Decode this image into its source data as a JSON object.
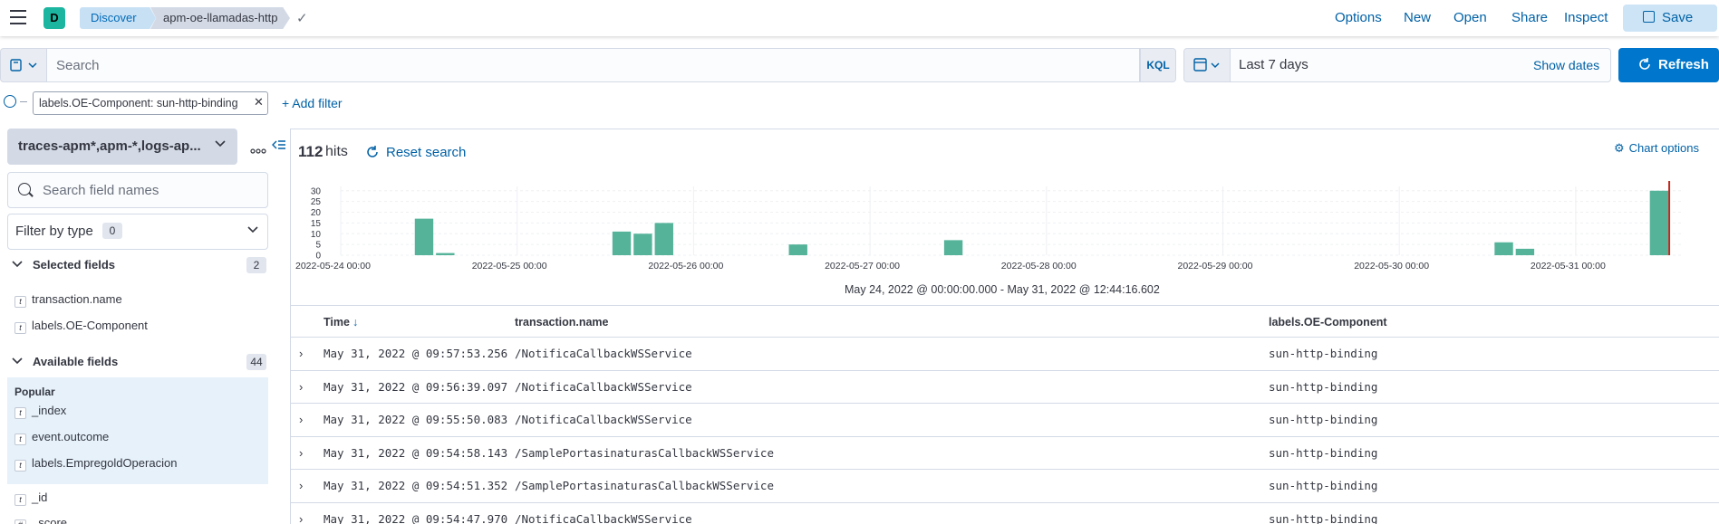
{
  "header": {
    "space_initial": "D",
    "breadcrumbs": [
      "Discover",
      "apm-oe-llamadas-http"
    ],
    "nav": [
      "Options",
      "New",
      "Open",
      "Share",
      "Inspect"
    ],
    "save_label": "Save"
  },
  "query": {
    "search_placeholder": "Search",
    "language": "KQL",
    "date_range": "Last 7 days",
    "show_dates": "Show dates",
    "refresh_label": "Refresh"
  },
  "filters": {
    "pills": [
      "labels.OE-Component: sun-http-binding"
    ],
    "add_label": "+ Add filter"
  },
  "sidebar": {
    "index_pattern": "traces-apm*,apm-*,logs-ap...",
    "field_search_placeholder": "Search field names",
    "filter_by_type_label": "Filter by type",
    "filter_by_type_count": "0",
    "selected_title": "Selected fields",
    "selected_count": "2",
    "selected_fields": [
      {
        "type": "t",
        "name": "transaction.name"
      },
      {
        "type": "t",
        "name": "labels.OE-Component"
      }
    ],
    "available_title": "Available fields",
    "available_count": "44",
    "popular_title": "Popular",
    "popular_fields": [
      {
        "type": "t",
        "name": "_index"
      },
      {
        "type": "t",
        "name": "event.outcome"
      },
      {
        "type": "t",
        "name": "labels.EmpregoldOperacion"
      }
    ],
    "other_fields": [
      {
        "type": "t",
        "name": "_id"
      },
      {
        "type": "#",
        "name": "_score"
      }
    ]
  },
  "main": {
    "hits": "112",
    "hits_label": "hits",
    "reset_label": "Reset search",
    "chart_options_label": "Chart options",
    "range_label": "May 24, 2022 @ 00:00:00.000 - May 31, 2022 @ 12:44:16.602"
  },
  "chart_data": {
    "type": "bar",
    "x_ticks": [
      "2022-05-24 00:00",
      "2022-05-25 00:00",
      "2022-05-26 00:00",
      "2022-05-27 00:00",
      "2022-05-28 00:00",
      "2022-05-29 00:00",
      "2022-05-30 00:00",
      "2022-05-31 00:00"
    ],
    "y_ticks": [
      0,
      5,
      10,
      15,
      20,
      25,
      30
    ],
    "ylim": [
      0,
      32
    ],
    "xlim_days": [
      0,
      7.53
    ],
    "bars": [
      {
        "day": 0.42,
        "value": 17
      },
      {
        "day": 0.54,
        "value": 1
      },
      {
        "day": 1.54,
        "value": 11
      },
      {
        "day": 1.66,
        "value": 10
      },
      {
        "day": 1.78,
        "value": 15
      },
      {
        "day": 2.54,
        "value": 5
      },
      {
        "day": 3.42,
        "value": 7
      },
      {
        "day": 6.54,
        "value": 6
      },
      {
        "day": 6.66,
        "value": 3
      },
      {
        "day": 7.42,
        "value": 30
      }
    ],
    "bar_width_days": 0.115,
    "bar_color": "#54b399",
    "now_marker_day": 7.53,
    "now_marker_color": "#bd271e"
  },
  "table": {
    "columns": [
      "Time",
      "transaction.name",
      "labels.OE-Component"
    ],
    "rows": [
      {
        "time": "May 31, 2022 @ 09:57:53.256",
        "name": "/NotificaCallbackWSService",
        "component": "sun-http-binding"
      },
      {
        "time": "May 31, 2022 @ 09:56:39.097",
        "name": "/NotificaCallbackWSService",
        "component": "sun-http-binding"
      },
      {
        "time": "May 31, 2022 @ 09:55:50.083",
        "name": "/NotificaCallbackWSService",
        "component": "sun-http-binding"
      },
      {
        "time": "May 31, 2022 @ 09:54:58.143",
        "name": "/SamplePortasinaturasCallbackWSService",
        "component": "sun-http-binding"
      },
      {
        "time": "May 31, 2022 @ 09:54:51.352",
        "name": "/SamplePortasinaturasCallbackWSService",
        "component": "sun-http-binding"
      },
      {
        "time": "May 31, 2022 @ 09:54:47.970",
        "name": "/NotificaCallbackWSService",
        "component": "sun-http-binding"
      }
    ]
  }
}
